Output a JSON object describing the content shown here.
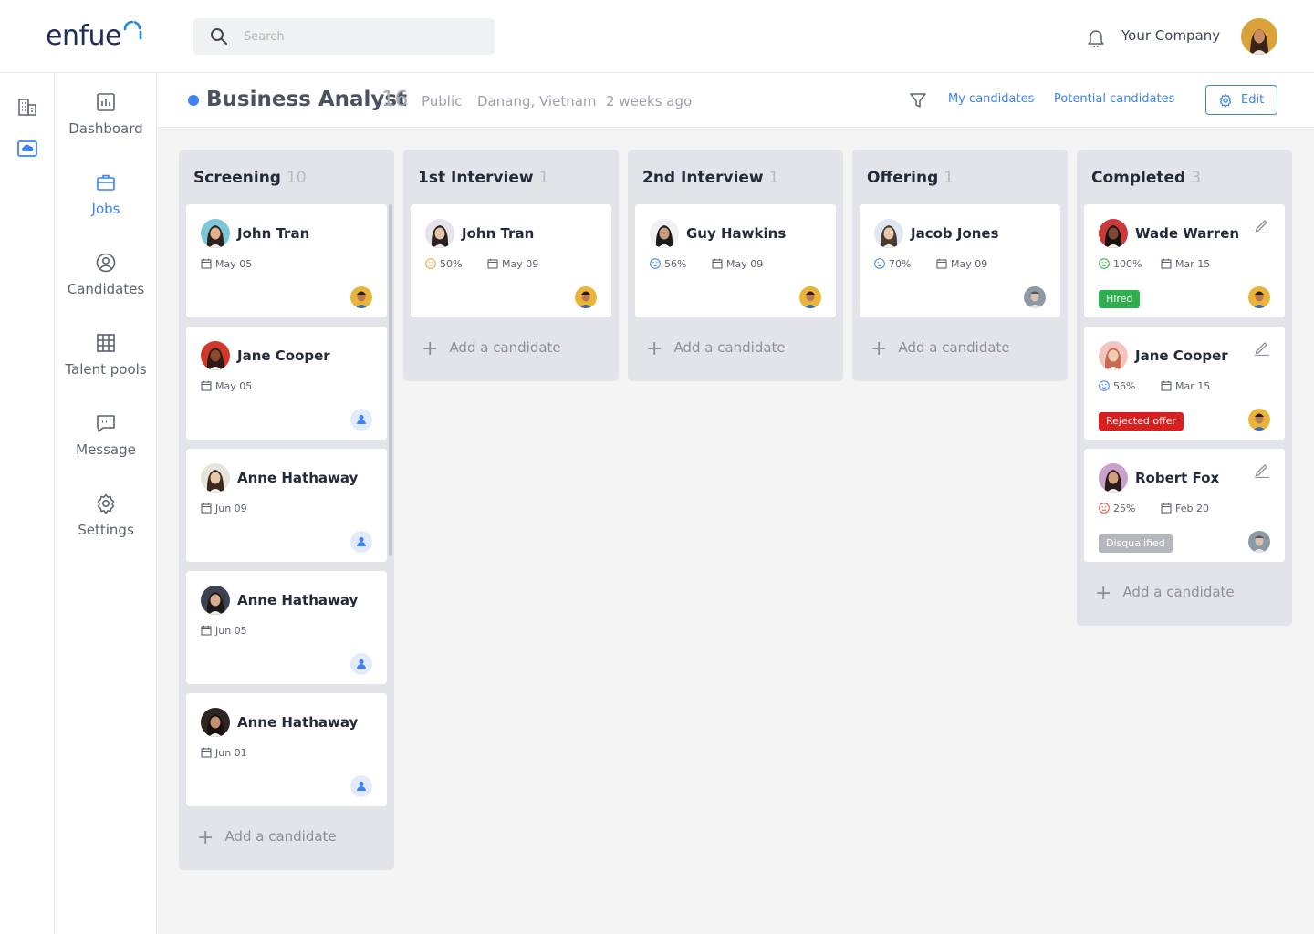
{
  "app": {
    "logo_text": "enfue"
  },
  "search": {
    "placeholder": "Search"
  },
  "header": {
    "company": "Your Company"
  },
  "nav": {
    "items": [
      {
        "label": "Dashboard"
      },
      {
        "label": "Jobs"
      },
      {
        "label": "Candidates"
      },
      {
        "label": "Talent pools"
      },
      {
        "label": "Message"
      },
      {
        "label": "Settings"
      }
    ]
  },
  "job": {
    "title": "Business Analyst",
    "count": "16",
    "visibility": "Public",
    "location": "Danang, Vietnam",
    "posted": "2 weeks ago",
    "my_candidates": "My candidates",
    "potential_candidates": "Potential candidates",
    "edit_label": "Edit"
  },
  "add_candidate_label": "Add a candidate",
  "columns": [
    {
      "name": "Screening",
      "count": "10",
      "cards": [
        {
          "name": "John Tran",
          "date": "May 05"
        },
        {
          "name": "Jane Cooper",
          "date": "May 05"
        },
        {
          "name": "Anne Hathaway",
          "date": "Jun 09"
        },
        {
          "name": "Anne Hathaway",
          "date": "Jun 05"
        },
        {
          "name": "Anne Hathaway",
          "date": "Jun 01"
        }
      ]
    },
    {
      "name": "1st Interview",
      "count": "1",
      "cards": [
        {
          "name": "John Tran",
          "score": "50%",
          "date": "May 09"
        }
      ]
    },
    {
      "name": "2nd Interview",
      "count": "1",
      "cards": [
        {
          "name": "Guy Hawkins",
          "score": "56%",
          "date": "May 09"
        }
      ]
    },
    {
      "name": "Offering",
      "count": "1",
      "cards": [
        {
          "name": "Jacob Jones",
          "score": "70%",
          "date": "May 09"
        }
      ]
    },
    {
      "name": "Completed",
      "count": "3",
      "cards": [
        {
          "name": "Wade Warren",
          "score": "100%",
          "date": "Mar 15",
          "status": "Hired"
        },
        {
          "name": "Jane Cooper",
          "score": "56%",
          "date": "Mar 15",
          "status": "Rejected offer"
        },
        {
          "name": "Robert Fox",
          "score": "25%",
          "date": "Feb 20",
          "status": "Disqualified"
        }
      ]
    }
  ],
  "colors": {
    "accent": "#3b82f6",
    "hired": "#2fae4e",
    "rejected": "#d91f1f",
    "disqualified": "#b4b7bd",
    "score_happy": "#2fae4e",
    "score_neutral": "#3b82f6",
    "score_meh": "#e8a33a",
    "score_sad": "#d94a3a"
  },
  "icons": [
    "search-icon",
    "bell-icon",
    "building-icon",
    "cloud-icon",
    "chart-icon",
    "briefcase-icon",
    "user-circle-icon",
    "grid-icon",
    "chat-icon",
    "gear-icon",
    "filter-icon",
    "calendar-icon",
    "pencil-icon",
    "plus-icon",
    "smile-icon"
  ]
}
